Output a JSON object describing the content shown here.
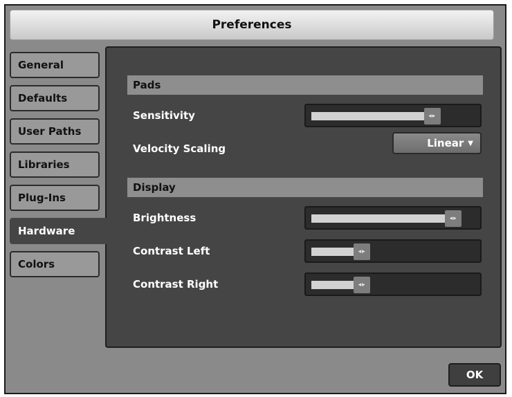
{
  "window": {
    "title": "Preferences"
  },
  "tabs": [
    {
      "label": "General"
    },
    {
      "label": "Defaults"
    },
    {
      "label": "User Paths"
    },
    {
      "label": "Libraries"
    },
    {
      "label": "Plug-Ins"
    },
    {
      "label": "Hardware",
      "active": true
    },
    {
      "label": "Colors"
    }
  ],
  "pads": {
    "header": "Pads",
    "sensitivity": {
      "label": "Sensitivity",
      "value_fraction": 0.74
    },
    "velocity_scaling": {
      "label": "Velocity Scaling",
      "value": "Linear"
    }
  },
  "display": {
    "header": "Display",
    "brightness": {
      "label": "Brightness",
      "value_fraction": 0.87
    },
    "contrast_left": {
      "label": "Contrast Left",
      "value_fraction": 0.31
    },
    "contrast_right": {
      "label": "Contrast Right",
      "value_fraction": 0.31
    }
  },
  "footer": {
    "ok_label": "OK"
  },
  "icons": {
    "slider_knob": "left-right-arrows-icon",
    "dropdown_caret": "triangle-down-icon"
  },
  "colors": {
    "panel_bg": "#454545",
    "window_bg": "#8a8a8a",
    "slider_fill": "#d2d2d2"
  }
}
